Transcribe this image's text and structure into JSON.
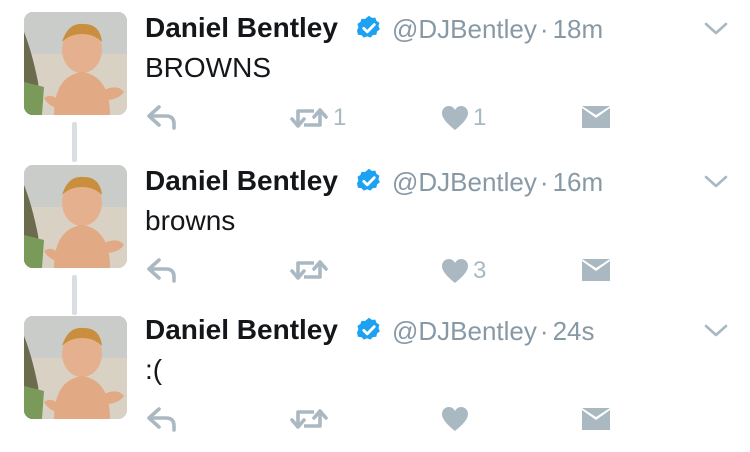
{
  "colors": {
    "icon": "#aab8c2",
    "name": "#14171a",
    "handle": "#8899a6",
    "verified": "#1da1f2",
    "thread_line": "#d8dee3"
  },
  "tweets": [
    {
      "name": "Daniel Bentley",
      "handle": "@DJBentley",
      "time": "18m",
      "text": "BROWNS",
      "retweets": "1",
      "likes": "1"
    },
    {
      "name": "Daniel Bentley",
      "handle": "@DJBentley",
      "time": "16m",
      "text": "browns",
      "retweets": "",
      "likes": "3"
    },
    {
      "name": "Daniel Bentley",
      "handle": "@DJBentley",
      "time": "24s",
      "text": ":(",
      "retweets": "",
      "likes": ""
    }
  ],
  "icons": {
    "reply": "reply-icon",
    "retweet": "retweet-icon",
    "like": "heart-icon",
    "dm": "envelope-icon",
    "caret": "chevron-down-icon",
    "verified": "verified-badge-icon"
  }
}
